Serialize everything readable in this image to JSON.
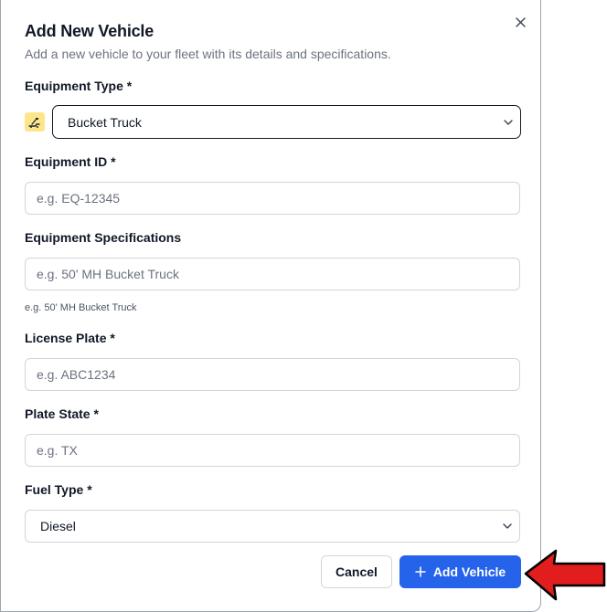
{
  "dialog": {
    "title": "Add New Vehicle",
    "subtitle": "Add a new vehicle to your fleet with its details and specifications.",
    "close_icon": "close-icon"
  },
  "fields": {
    "equipment_type": {
      "label": "Equipment Type *",
      "value": "Bucket Truck",
      "icon": "bucket-truck-icon"
    },
    "equipment_id": {
      "label": "Equipment ID *",
      "placeholder": "e.g. EQ-12345"
    },
    "equipment_specs": {
      "label": "Equipment Specifications",
      "placeholder": "e.g. 50' MH Bucket Truck",
      "helper": "e.g. 50' MH Bucket Truck"
    },
    "license_plate": {
      "label": "License Plate *",
      "placeholder": "e.g. ABC1234"
    },
    "plate_state": {
      "label": "Plate State *",
      "placeholder": "e.g. TX"
    },
    "fuel_type": {
      "label": "Fuel Type *",
      "value": "Diesel"
    }
  },
  "actions": {
    "cancel_label": "Cancel",
    "add_label": "Add Vehicle",
    "add_icon": "plus-icon"
  },
  "colors": {
    "primary": "#2563eb",
    "icon_bg": "#fde68a",
    "annotation_arrow": "#e11d1d"
  }
}
